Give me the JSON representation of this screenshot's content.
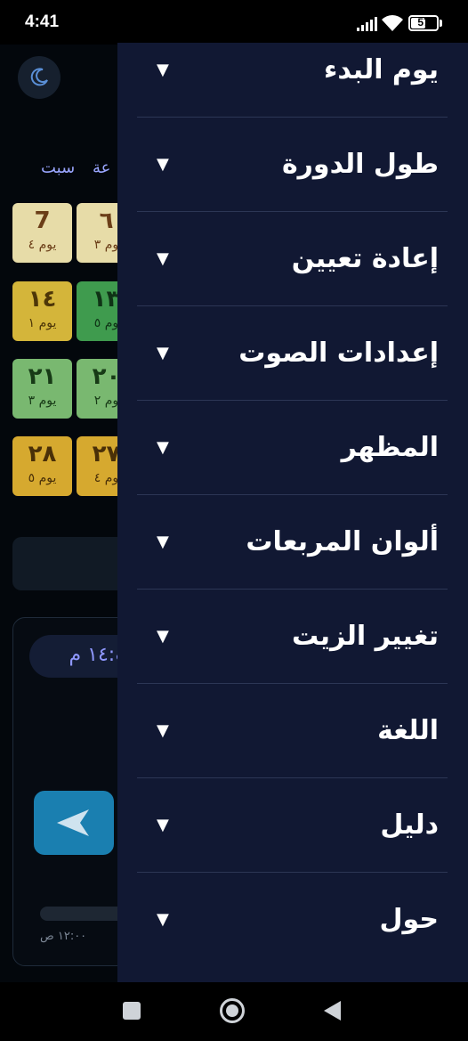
{
  "status_bar": {
    "time": "4:41",
    "battery_level": "57",
    "battery_fraction": 0.57
  },
  "calendar": {
    "weekdays": {
      "sat": "سبت",
      "fri": "عة"
    },
    "cells": [
      {
        "num": "7",
        "day": "يوم ٤",
        "color": "#e7dca8"
      },
      {
        "num": "٦",
        "day": "وم ٣",
        "color": "#e7dca8"
      },
      {
        "num": "١٤",
        "day": "يوم ١",
        "color": "#d4b53a"
      },
      {
        "num": "١٣",
        "day": "وم ٥",
        "color": "#3f9b4e"
      },
      {
        "num": "٢١",
        "day": "يوم ٣",
        "color": "#79b870"
      },
      {
        "num": "٢٠",
        "day": "وم ٢",
        "color": "#79b870"
      },
      {
        "num": "٢٨",
        "day": "يوم ٥",
        "color": "#d6a92f"
      },
      {
        "num": "٢٧",
        "day": "وم ٤",
        "color": "#d6a92f"
      }
    ]
  },
  "player": {
    "time_display": "١٤:٤ م",
    "start_time": "١٢:٠٠ ص"
  },
  "menu": {
    "items": [
      {
        "label": "يوم البدء"
      },
      {
        "label": "طول الدورة"
      },
      {
        "label": "إعادة تعيين"
      },
      {
        "label": "إعدادات الصوت"
      },
      {
        "label": "المظهر"
      },
      {
        "label": "ألوان المربعات"
      },
      {
        "label": "تغيير الزيت"
      },
      {
        "label": "اللغة"
      },
      {
        "label": "دليل"
      },
      {
        "label": "حول"
      }
    ],
    "arrow_glyph": "▼"
  },
  "colors": {
    "drawer_bg": "#111833",
    "accent_blue": "#1a7fb0",
    "weekday_text": "#9aa6ff"
  }
}
